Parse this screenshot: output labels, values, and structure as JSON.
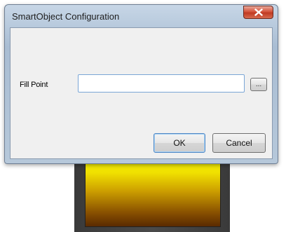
{
  "window": {
    "title": "SmartObject Configuration",
    "close_icon": "close-x-icon"
  },
  "form": {
    "fill_point": {
      "label": "Fill Point",
      "value": "",
      "placeholder": ""
    },
    "browse_label": "..."
  },
  "buttons": {
    "ok_label": "OK",
    "cancel_label": "Cancel"
  },
  "background_graphic": {
    "type": "tank-fill",
    "colors": {
      "top": "#f4f400",
      "bottom": "#5a2a00",
      "frame": "#3a3a3a"
    }
  }
}
